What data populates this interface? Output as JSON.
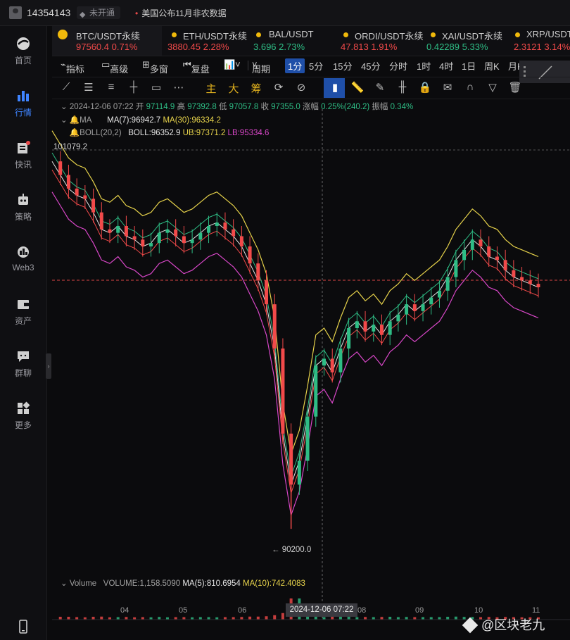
{
  "header": {
    "user_id": "14354143",
    "vip_label": "未开通",
    "news": "美国公布11月非农数据"
  },
  "sidebar": {
    "items": [
      {
        "label": "首页"
      },
      {
        "label": "行情"
      },
      {
        "label": "快讯"
      },
      {
        "label": "策略"
      },
      {
        "label": "Web3"
      },
      {
        "label": "资产"
      },
      {
        "label": "群聊"
      },
      {
        "label": "更多"
      }
    ]
  },
  "tabs": [
    {
      "name": "BTC/USDT永续",
      "price": "97560.4",
      "change": "0.71%",
      "color": "red"
    },
    {
      "name": "ETH/USDT永续",
      "price": "3880.45",
      "change": "2.28%",
      "color": "red"
    },
    {
      "name": "BAL/USDT",
      "price": "3.696",
      "change": "2.73%",
      "color": "green"
    },
    {
      "name": "ORDI/USDT永续",
      "price": "47.813",
      "change": "1.91%",
      "color": "red"
    },
    {
      "name": "XAI/USDT永续",
      "price": "0.42289",
      "change": "5.33%",
      "color": "green"
    },
    {
      "name": "XRP/USDT",
      "price": "2.3121",
      "change": "3.14%",
      "color": "red"
    }
  ],
  "toolbar": {
    "indicators": "指标",
    "advanced": "高级",
    "multi_window": "多窗",
    "replay": "复盘",
    "period": "周期",
    "intervals": [
      "1分",
      "5分",
      "15分",
      "45分",
      "分时",
      "1时",
      "4时",
      "1日",
      "周K",
      "月K"
    ],
    "selected_interval": "1分",
    "tools_text": [
      "主",
      "大",
      "筹"
    ]
  },
  "info_bar": {
    "datetime": "2024-12-06 07:22",
    "open_label": "开",
    "open": "97114.9",
    "high_label": "高",
    "high": "97392.8",
    "low_label": "低",
    "low": "97057.8",
    "close_label": "收",
    "close": "97355.0",
    "change_label": "涨幅",
    "change": "0.25%(240.2)",
    "amp_label": "振幅",
    "amp": "0.34%"
  },
  "ma_bar": {
    "label": "MA",
    "ma7": "MA(7):96942.7",
    "ma30": "MA(30):96334.2"
  },
  "boll_bar": {
    "label": "BOLL(20,2)",
    "boll": "BOLL:96352.9",
    "ub": "UB:97371.2",
    "lb": "LB:95334.6"
  },
  "volume_bar": {
    "label": "Volume",
    "volume": "VOLUME:1,158.5090",
    "ma5": "MA(5):810.6954",
    "ma10": "MA(10):742.4083"
  },
  "chart_data": {
    "type": "line",
    "title": "",
    "high_marker": "101079.2",
    "low_marker": "← 90200.0",
    "x_ticks": [
      "04",
      "05",
      "06",
      "07",
      "08",
      "09",
      "10",
      "11"
    ],
    "selected_time": "2024-12-06 07:22",
    "price_series": [
      101000,
      100600,
      100200,
      100000,
      99900,
      99500,
      99000,
      98900,
      99100,
      98800,
      98700,
      98500,
      98600,
      98900,
      99000,
      98800,
      98600,
      98700,
      98900,
      99100,
      99200,
      99000,
      98800,
      98500,
      98000,
      97500,
      96800,
      95500,
      93000,
      91500,
      92200,
      93500,
      95000,
      95200,
      94800,
      95500,
      96100,
      96300,
      96000,
      96200,
      95900,
      96300,
      96500,
      96800,
      96600,
      96800,
      97000,
      97200,
      97600,
      98100,
      98400,
      98700,
      98500,
      98200,
      98100,
      97800,
      97600,
      97500,
      97400,
      97300
    ],
    "range_y": [
      89500,
      101500
    ]
  },
  "watermark": "@区块老九"
}
